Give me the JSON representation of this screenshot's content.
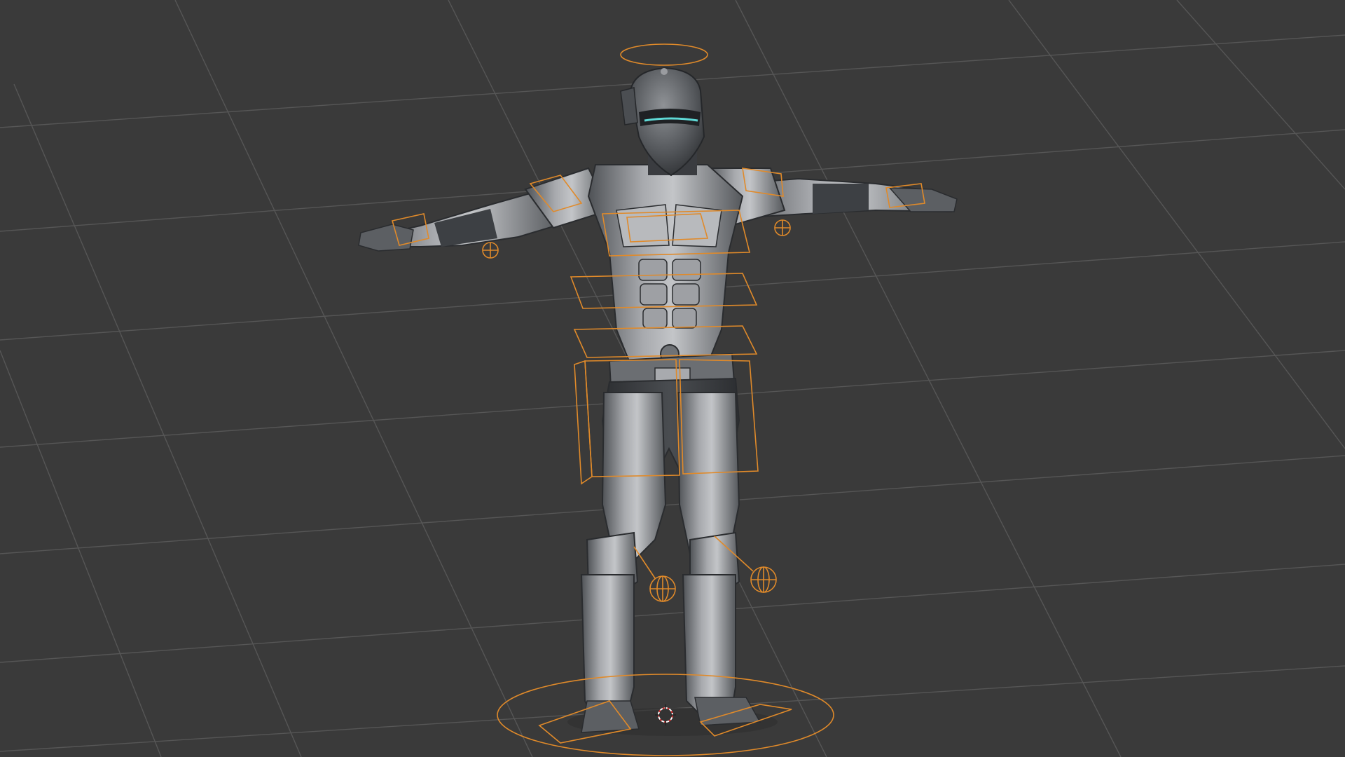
{
  "viewport": {
    "background_color": "#3a3a3a",
    "grid_line_color": "#5a5a5a",
    "rig_control_color": "#e08a2a",
    "subject": "armored-character-t-pose",
    "subject_armor_color": "#8e9094",
    "visor_glow_color": "#5fd9d6",
    "icons": [
      "3d-cursor-icon"
    ]
  }
}
